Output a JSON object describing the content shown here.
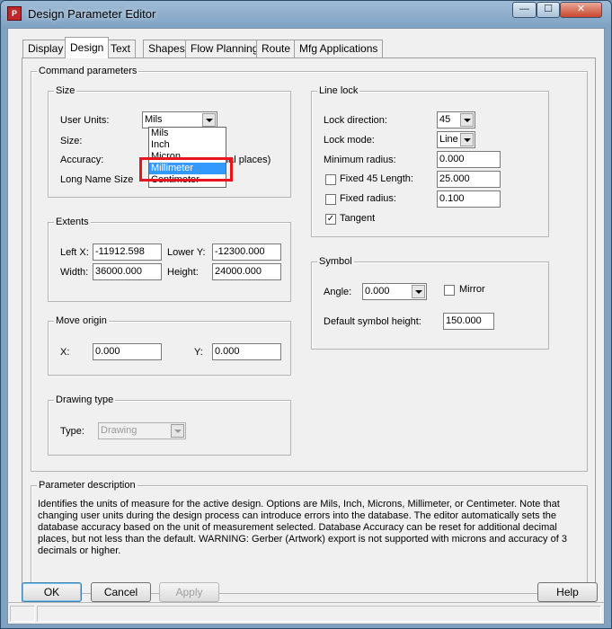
{
  "window": {
    "title": "Design Parameter Editor",
    "icon": "app-icon",
    "min": "—",
    "max": "☐",
    "close": "✕"
  },
  "tabs": [
    "Display",
    "Design",
    "Text",
    "Shapes",
    "Flow Planning",
    "Route",
    "Mfg Applications"
  ],
  "active_tab": "Design",
  "command_parameters": {
    "title": "Command parameters",
    "size": {
      "title": "Size",
      "user_units_label": "User Units:",
      "user_units_value": "Mils",
      "size_label": "Size:",
      "accuracy_label": "Accuracy:",
      "accuracy_suffix": "mal places)",
      "long_name_label": "Long Name Size",
      "units_options": [
        "Mils",
        "Inch",
        "Microns",
        "Millimeter",
        "Centimeter"
      ],
      "units_options_visible": [
        "Mils",
        "Inch",
        "Micron",
        "Millimeter",
        "Centimeter"
      ],
      "units_selected": "Millimeter"
    },
    "extents": {
      "title": "Extents",
      "left_x_label": "Left X:",
      "left_x": "-11912.598",
      "lower_y_label": "Lower Y:",
      "lower_y": "-12300.000",
      "width_label": "Width:",
      "width": "36000.000",
      "height_label": "Height:",
      "height": "24000.000"
    },
    "move_origin": {
      "title": "Move origin",
      "x_label": "X:",
      "x": "0.000",
      "y_label": "Y:",
      "y": "0.000"
    },
    "drawing_type": {
      "title": "Drawing type",
      "type_label": "Type:",
      "type_value": "Drawing"
    },
    "line_lock": {
      "title": "Line lock",
      "lock_direction_label": "Lock direction:",
      "lock_direction": "45",
      "lock_mode_label": "Lock mode:",
      "lock_mode": "Line",
      "min_radius_label": "Minimum radius:",
      "min_radius": "0.000",
      "fixed45_label": "Fixed 45 Length:",
      "fixed45": "25.000",
      "fixed45_checked": false,
      "fixed_radius_label": "Fixed radius:",
      "fixed_radius": "0.100",
      "fixed_radius_checked": false,
      "tangent_label": "Tangent",
      "tangent_checked": true
    },
    "symbol": {
      "title": "Symbol",
      "angle_label": "Angle:",
      "angle": "0.000",
      "mirror_label": "Mirror",
      "mirror_checked": false,
      "default_height_label": "Default symbol height:",
      "default_height": "150.000"
    }
  },
  "parameter_description": {
    "title": "Parameter description",
    "text": "Identifies the units of measure for the active design. Options are Mils, Inch, Microns, Millimeter, or Centimeter. Note that changing user units during the design process can introduce errors into the database.  The editor automatically sets the database accuracy based on the unit of measurement selected. Database Accuracy can be reset for additional decimal places, but not less than the default. WARNING: Gerber (Artwork) export is not supported with microns and accuracy of 3 decimals or higher."
  },
  "buttons": {
    "ok": "OK",
    "cancel": "Cancel",
    "apply": "Apply",
    "help": "Help"
  },
  "colors": {
    "highlight": "#e8141e",
    "selection": "#3399ff"
  }
}
